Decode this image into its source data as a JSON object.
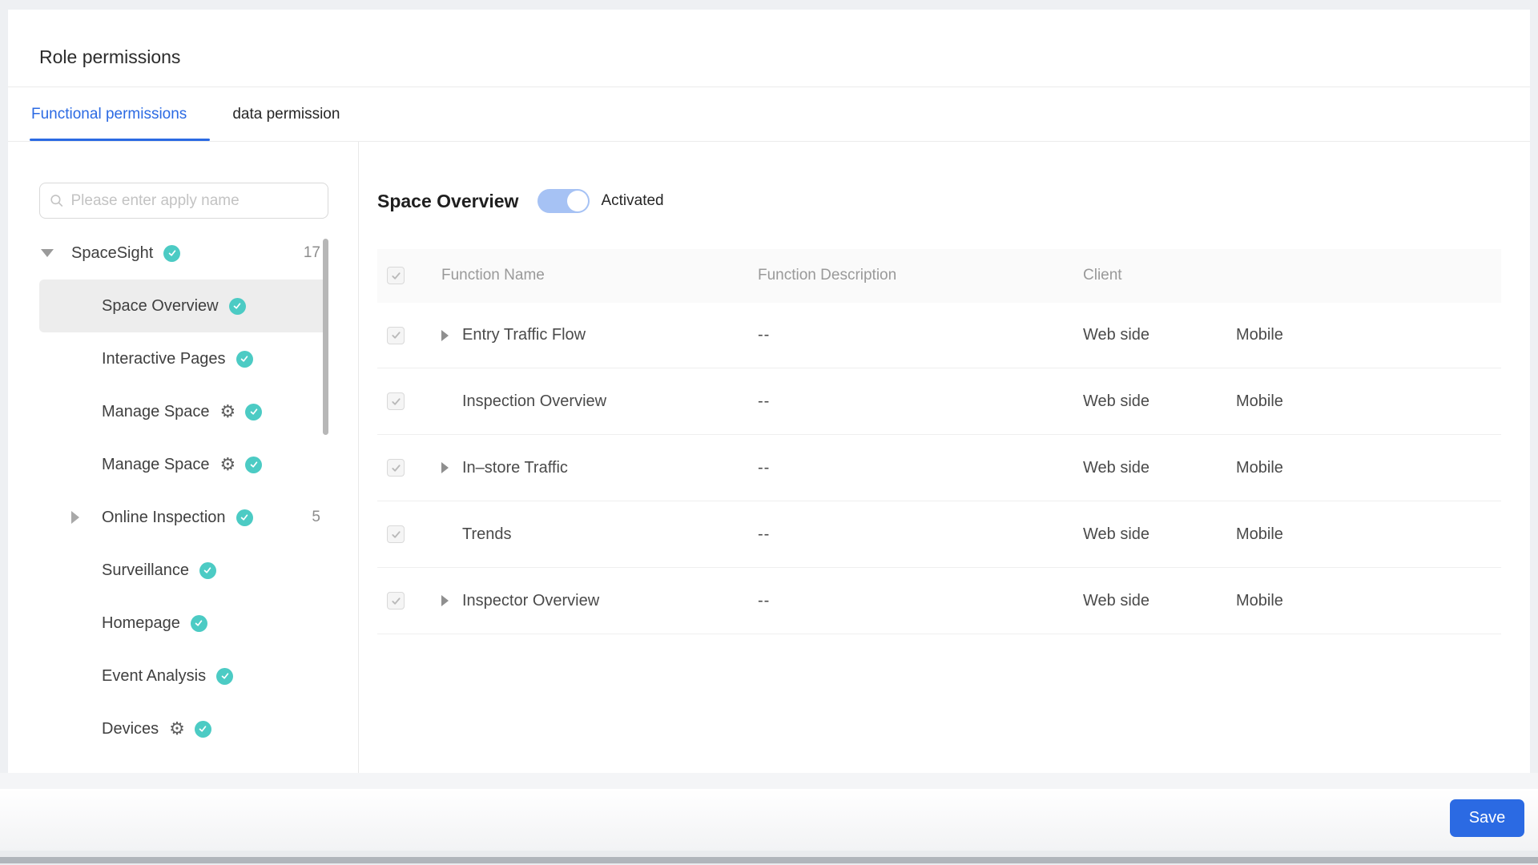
{
  "page": {
    "title": "Role permissions",
    "tabs": [
      {
        "label": "Functional permissions",
        "active": true
      },
      {
        "label": "data permission",
        "active": false
      }
    ]
  },
  "sidebar": {
    "search_placeholder": "Please enter apply name",
    "root": {
      "label": "SpaceSight",
      "count": "17",
      "checked": true,
      "expanded": true
    },
    "items": [
      {
        "label": "Space Overview",
        "selected": true,
        "checked": true
      },
      {
        "label": "Interactive Pages",
        "checked": true
      },
      {
        "label": "Manage Space",
        "gear": true,
        "checked": true
      },
      {
        "label": "Manage Space",
        "gear": true,
        "checked": true
      },
      {
        "label": "Online Inspection",
        "caret": true,
        "count": "5",
        "checked": true
      },
      {
        "label": "Surveillance",
        "checked": true
      },
      {
        "label": "Homepage",
        "checked": true
      },
      {
        "label": "Event Analysis",
        "checked": true
      },
      {
        "label": "Devices",
        "gear": true,
        "checked": true
      }
    ]
  },
  "main": {
    "heading": "Space Overview",
    "toggle": {
      "state": "on",
      "label": "Activated"
    },
    "table": {
      "headers": {
        "name": "Function Name",
        "description": "Function Description",
        "client": "Client"
      },
      "rows": [
        {
          "name": "Entry Traffic Flow",
          "expandable": true,
          "checked": true,
          "description": "--",
          "client_web": "Web side",
          "client_mobile": "Mobile"
        },
        {
          "name": "Inspection Overview",
          "expandable": false,
          "checked": true,
          "description": "--",
          "client_web": "Web side",
          "client_mobile": "Mobile"
        },
        {
          "name": "In–store Traffic",
          "expandable": true,
          "checked": true,
          "description": "--",
          "client_web": "Web side",
          "client_mobile": "Mobile"
        },
        {
          "name": "Trends",
          "expandable": false,
          "checked": true,
          "description": "--",
          "client_web": "Web side",
          "client_mobile": "Mobile"
        },
        {
          "name": "Inspector Overview",
          "expandable": true,
          "checked": true,
          "description": "--",
          "client_web": "Web side",
          "client_mobile": "Mobile"
        }
      ]
    }
  },
  "footer": {
    "save_label": "Save"
  },
  "colors": {
    "accent_blue": "#2b6ae3",
    "check_teal": "#4ccbc4",
    "toggle_track": "#a6c2f4",
    "header_bg": "#fafafa",
    "disabled_check": "#b9b9b9"
  }
}
